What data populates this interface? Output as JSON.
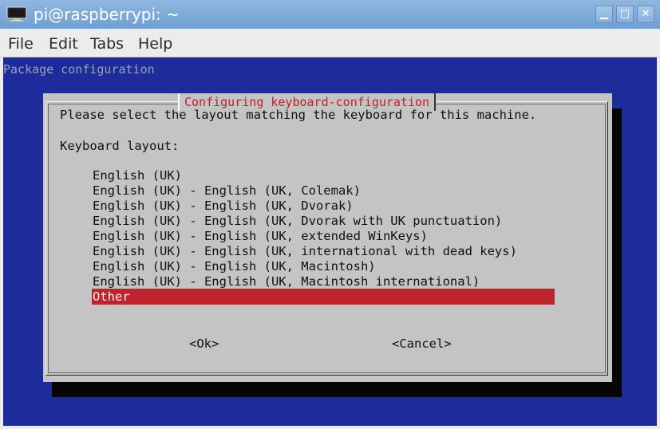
{
  "window": {
    "title": "pi@raspberrypi: ~"
  },
  "menu": [
    "File",
    "Edit",
    "Tabs",
    "Help"
  ],
  "terminal": {
    "header": "Package configuration",
    "dialog": {
      "title": "Configuring keyboard-configuration",
      "prompt": "Please select the layout matching the keyboard for this machine.",
      "label": "Keyboard layout:",
      "options": [
        "English (UK)",
        "English (UK) - English (UK, Colemak)",
        "English (UK) - English (UK, Dvorak)",
        "English (UK) - English (UK, Dvorak with UK punctuation)",
        "English (UK) - English (UK, extended WinKeys)",
        "English (UK) - English (UK, international with dead keys)",
        "English (UK) - English (UK, Macintosh)",
        "English (UK) - English (UK, Macintosh international)"
      ],
      "selected_option": "Other",
      "ok_button": "<Ok>",
      "cancel_button": "<Cancel>"
    }
  },
  "colors": {
    "titlebar": "#7fa9d8",
    "terminal_bg": "#1e2b9a",
    "dialog_bg": "#c4c4c4",
    "accent_red": "#c0222e"
  },
  "icons": {
    "app": "terminal-icon",
    "minimize": "minimize-icon",
    "maximize": "maximize-icon",
    "close": "close-icon"
  }
}
